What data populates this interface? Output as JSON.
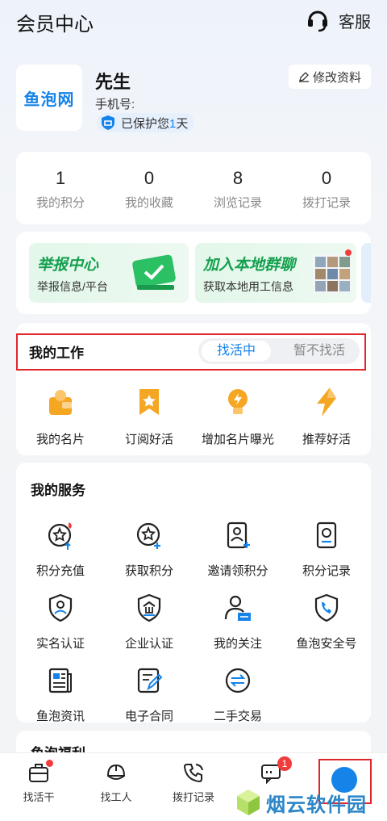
{
  "header": {
    "title": "会员中心",
    "service_label": "客服"
  },
  "profile": {
    "logo_text": "鱼泡网",
    "name": "先生",
    "phone_label": "手机号:",
    "protect_prefix": "已保护您",
    "protect_days": "1",
    "protect_suffix": "天",
    "edit_label": "修改资料"
  },
  "stats": [
    {
      "value": "1",
      "label": "我的积分"
    },
    {
      "value": "0",
      "label": "我的收藏"
    },
    {
      "value": "8",
      "label": "浏览记录"
    },
    {
      "value": "0",
      "label": "拨打记录"
    }
  ],
  "banners": [
    {
      "title": "举报中心",
      "subtitle": "举报信息/平台"
    },
    {
      "title": "加入本地群聊",
      "subtitle": "获取本地用工信息"
    }
  ],
  "work": {
    "title": "我的工作",
    "toggle_on": "找活中",
    "toggle_off": "暂不找活",
    "tools": [
      {
        "label": "我的名片",
        "icon": "card-icon"
      },
      {
        "label": "订阅好活",
        "icon": "bookmark-star-icon"
      },
      {
        "label": "增加名片曝光",
        "icon": "bulb-icon"
      },
      {
        "label": "推荐好活",
        "icon": "lightning-icon"
      }
    ]
  },
  "services": {
    "title": "我的服务",
    "items": [
      {
        "label": "积分充值",
        "icon": "star-coin-up-icon"
      },
      {
        "label": "获取积分",
        "icon": "star-coin-plus-icon"
      },
      {
        "label": "邀请领积分",
        "icon": "invite-icon"
      },
      {
        "label": "积分记录",
        "icon": "record-icon"
      },
      {
        "label": "实名认证",
        "icon": "shield-user-icon"
      },
      {
        "label": "企业认证",
        "icon": "shield-company-icon"
      },
      {
        "label": "我的关注",
        "icon": "follow-icon"
      },
      {
        "label": "鱼泡安全号",
        "icon": "phone-shield-icon"
      },
      {
        "label": "鱼泡资讯",
        "icon": "news-icon"
      },
      {
        "label": "电子合同",
        "icon": "contract-icon"
      },
      {
        "label": "二手交易",
        "icon": "exchange-icon"
      }
    ]
  },
  "welfare": {
    "title": "鱼泡福利"
  },
  "tabbar": [
    {
      "label": "找活干",
      "icon": "toolbox-icon"
    },
    {
      "label": "找工人",
      "icon": "helmet-icon"
    },
    {
      "label": "拨打记录",
      "icon": "phone-icon"
    },
    {
      "label": "",
      "icon": "message-icon",
      "badge": "1"
    },
    {
      "label": "",
      "icon": "me-icon"
    }
  ],
  "watermark": {
    "text": "烟云软件园"
  },
  "colors": {
    "accent": "#1583e8",
    "green": "#14a04e",
    "red": "#e0262b",
    "orange": "#f5a623"
  }
}
